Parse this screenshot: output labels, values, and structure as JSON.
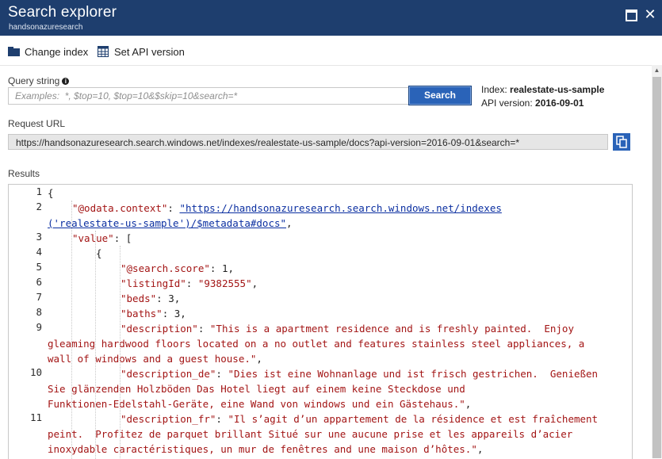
{
  "window": {
    "title": "Search explorer",
    "subtitle": "handsonazuresearch"
  },
  "commands": {
    "change_index": "Change index",
    "set_api_version": "Set API version"
  },
  "query": {
    "label": "Query string",
    "placeholder": "Examples:  *, $top=10, $top=10&$skip=10&search=*",
    "value": ""
  },
  "search_button": "Search",
  "index_info": {
    "index_label": "Index: ",
    "index_value": "realestate-us-sample",
    "api_label": "API version: ",
    "api_value": "2016-09-01"
  },
  "request_url": {
    "label": "Request URL",
    "value": "https://handsonazuresearch.search.windows.net/indexes/realestate-us-sample/docs?api-version=2016-09-01&search=*"
  },
  "results": {
    "label": "Results",
    "line_numbers": [
      "1",
      "2",
      "3",
      "4",
      "5",
      "6",
      "7",
      "8",
      "9",
      "10",
      "11"
    ],
    "lines": [
      {
        "num": "1",
        "text": "{"
      },
      {
        "num": "2",
        "key": "\"@odata.context\"",
        "sep": ": ",
        "link": "\"https://handsonazuresearch.search.windows.net/indexes",
        "link2": "('realestate-us-sample')/$metadata#docs\"",
        "tail": ","
      },
      {
        "num": "3",
        "key": "\"value\"",
        "tail": ": ["
      },
      {
        "num": "4",
        "text": "{"
      },
      {
        "num": "5",
        "key": "\"@search.score\"",
        "tail": ": 1,"
      },
      {
        "num": "6",
        "key": "\"listingId\"",
        "sep": ": ",
        "str": "\"9382555\"",
        "tail": ","
      },
      {
        "num": "7",
        "key": "\"beds\"",
        "tail": ": 3,"
      },
      {
        "num": "8",
        "key": "\"baths\"",
        "tail": ": 3,"
      },
      {
        "num": "9",
        "key": "\"description\"",
        "sep": ": ",
        "str": "\"This is a apartment residence and is freshly painted.  Enjoy",
        "cont": [
          "gleaming hardwood floors located on a no outlet and features stainless steel appliances, a",
          "wall of windows and a guest house.\""
        ],
        "tail": ","
      },
      {
        "num": "10",
        "key": "\"description_de\"",
        "sep": ": ",
        "str": "\"Dies ist eine Wohnanlage und ist frisch gestrichen.  Genießen",
        "cont": [
          "Sie glänzenden Holzböden Das Hotel liegt auf einem keine Steckdose und",
          "Funktionen-Edelstahl-Geräte, eine Wand von windows und ein Gästehaus.\""
        ],
        "tail": ","
      },
      {
        "num": "11",
        "key": "\"description_fr\"",
        "sep": ": ",
        "str": "\"Il s’agit d’un appartement de la résidence et est fraîchement",
        "cont": [
          "peint.  Profitez de parquet brillant Situé sur une aucune prise et les appareils d’acier",
          "inoxydable caractéristiques, un mur de fenêtres and une maison d’hôtes.\""
        ],
        "tail": ","
      }
    ]
  },
  "icons": {
    "change_index": "folder-icon",
    "set_api_version": "table-icon",
    "query_info": "info-icon",
    "copy": "copy-icon",
    "maximize": "maximize-icon",
    "close": "close-icon"
  },
  "colors": {
    "titlebar": "#1e3e6e",
    "accent": "#2a63b8",
    "json_key": "#a31515",
    "json_link": "#0b2fa1"
  }
}
